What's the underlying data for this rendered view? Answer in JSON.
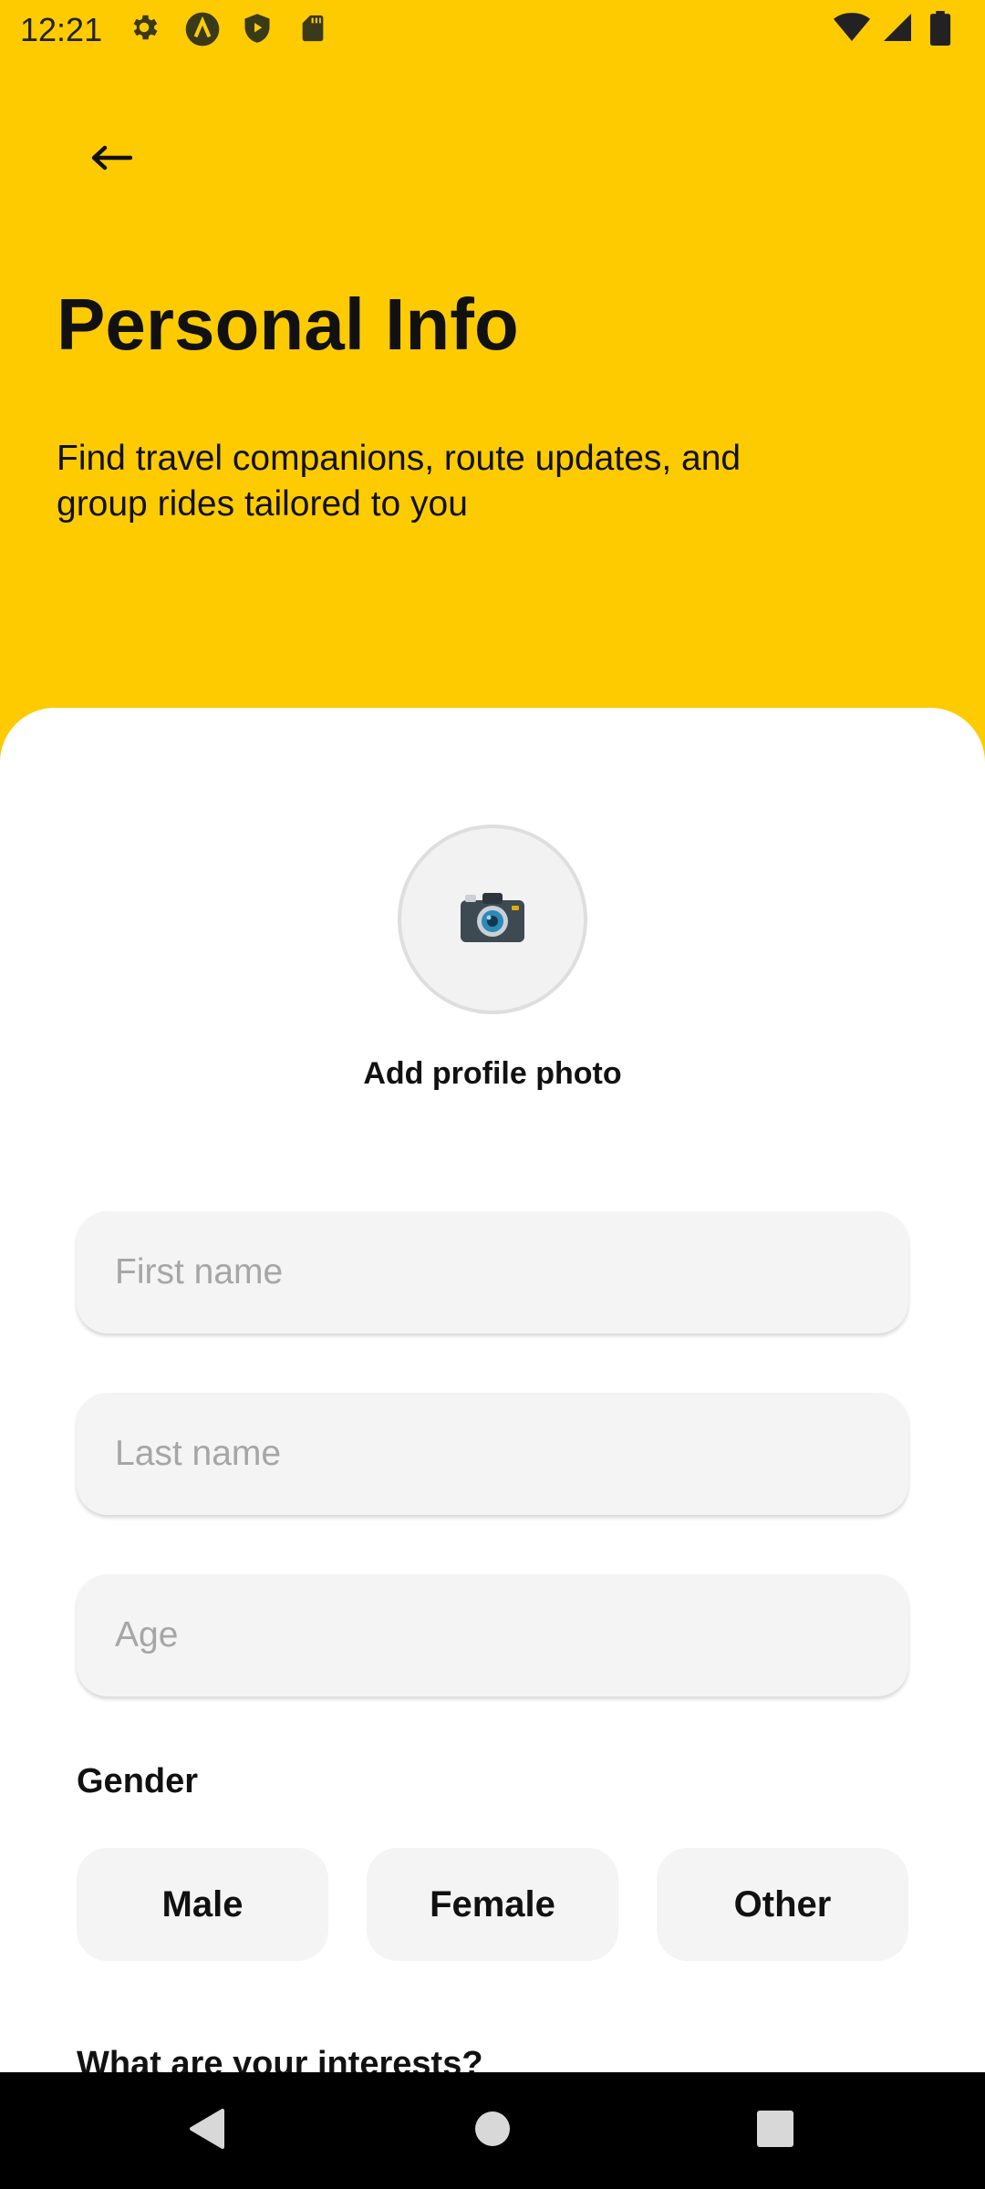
{
  "status_bar": {
    "time": "12:21",
    "left_icons": [
      "gear-icon",
      "a-badge-icon",
      "shield-play-icon",
      "sd-card-icon"
    ],
    "right_icons": [
      "wifi-icon",
      "cellular-signal-icon",
      "battery-icon"
    ]
  },
  "header": {
    "back_icon": "arrow-left-icon",
    "title": "Personal Info",
    "subtitle": "Find travel companions, route updates, and group rides tailored to you",
    "background_color": "#FECB00"
  },
  "profile_photo": {
    "icon": "camera-icon",
    "label": "Add profile photo"
  },
  "form": {
    "first_name": {
      "value": "",
      "placeholder": "First name"
    },
    "last_name": {
      "value": "",
      "placeholder": "Last name"
    },
    "age": {
      "value": "",
      "placeholder": "Age"
    }
  },
  "gender": {
    "label": "Gender",
    "options": [
      "Male",
      "Female",
      "Other"
    ]
  },
  "interests": {
    "label": "What are your interests?"
  },
  "nav_bar": {
    "icons": [
      "back-triangle-icon",
      "home-circle-icon",
      "recents-square-icon"
    ]
  }
}
